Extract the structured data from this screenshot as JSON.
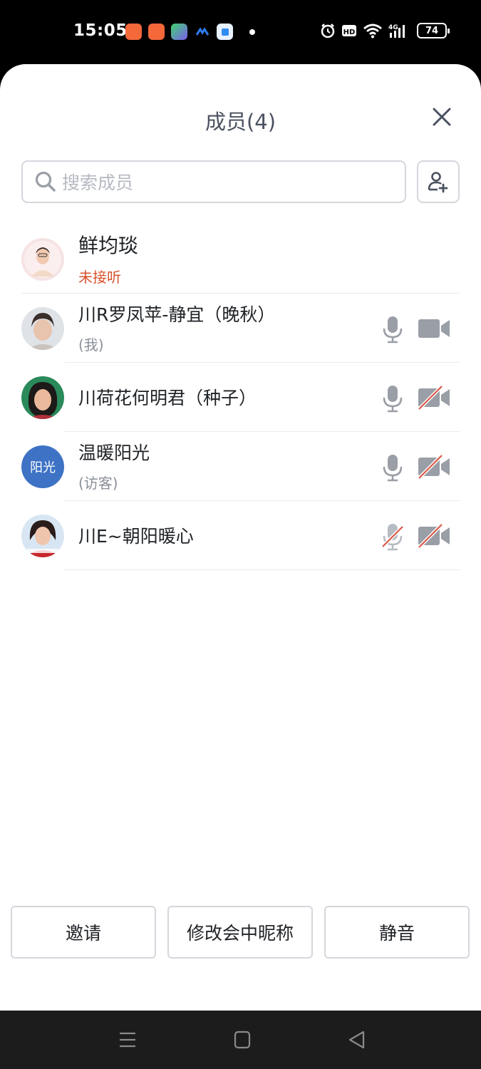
{
  "status_bar": {
    "time": "15:05",
    "battery": "74",
    "icons": [
      "alarm-icon",
      "hd-icon",
      "wifi-icon",
      "signal-4g-icon",
      "battery-icon"
    ]
  },
  "sheet": {
    "title": "成员(4)",
    "search": {
      "placeholder": "搜索成员"
    }
  },
  "members": [
    {
      "name": "鲜均琰",
      "sub": "未接听",
      "sub_style": "alert",
      "avatar": "photo",
      "mic": null,
      "cam": null
    },
    {
      "name": "川R罗凤苹-静宜（晚秋）",
      "sub": "(我)",
      "avatar": "photo",
      "mic": "on",
      "cam": "on"
    },
    {
      "name": "川荷花何明君（种子）",
      "sub": "",
      "avatar": "photo",
      "mic": "on",
      "cam": "off"
    },
    {
      "name": "温暖阳光",
      "sub": "(访客)",
      "avatar": "text",
      "avatar_text": "阳光",
      "mic": "on",
      "cam": "off"
    },
    {
      "name": "川E~朝阳暖心",
      "sub": "",
      "avatar": "photo",
      "mic": "off",
      "cam": "off"
    }
  ],
  "buttons": {
    "invite": "邀请",
    "rename": "修改会中昵称",
    "mute": "静音"
  },
  "colors": {
    "accent_blue": "#3e72c5",
    "alert_orange": "#d8522d",
    "icon_gray": "#9a9ea6",
    "disabled_red": "#d85a4a"
  }
}
